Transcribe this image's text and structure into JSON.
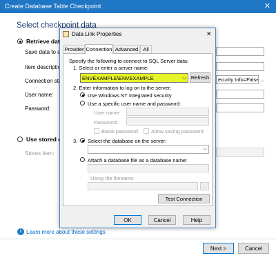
{
  "window": {
    "title": "Create Database Table Checkpoint",
    "close_glyph": "✕"
  },
  "main": {
    "heading": "Select checkpoint data",
    "retrieve_label": "Retrieve data",
    "save_data_label": "Save data to a ne",
    "item_description_label": "Item description:",
    "connection_string_label": "Connection string",
    "connection_string_value": "ecurity Info=False;",
    "ellipsis": "...",
    "user_name_label": "User name:",
    "password_label": "Password:",
    "use_stored_label": "Use stored da",
    "stores_item_label": "Stores item:",
    "learn_more_link": "Learn more about these settings",
    "next_button": "Next >",
    "cancel_button": "Cancel"
  },
  "dialog": {
    "title": "Data Link Properties",
    "close_glyph": "✕",
    "tabs": [
      "Provider",
      "Connection",
      "Advanced",
      "All"
    ],
    "instruction": "Specify the following to connect to SQL Server data:",
    "step1_label": "1. Select or enter a server name:",
    "server_name": "ENVEXAMPLE\\ENVEXAMPLE",
    "refresh_button": "Refresh",
    "step2_label": "2. Enter information to log on to the server:",
    "nt_security_label": "Use Windows NT Integrated security",
    "specific_user_label": "Use a specific user name and password:",
    "user_name_label": "User name:",
    "password_label": "Password:",
    "blank_password_label": "Blank password",
    "allow_saving_label": "Allow saving password",
    "step3_label": "3.",
    "select_db_label": "Select the database on the server:",
    "attach_db_label": "Attach a database file as a database name:",
    "using_filename_label": "Using the filename:",
    "browse_glyph": "...",
    "test_connection_button": "Test Connection",
    "ok_button": "OK",
    "cancel_button": "Cancel",
    "help_button": "Help"
  },
  "colors": {
    "titlebar": "#1f76c4",
    "highlight": "#e6f528",
    "link": "#0066cc",
    "info_icon": "#1c79c8"
  }
}
